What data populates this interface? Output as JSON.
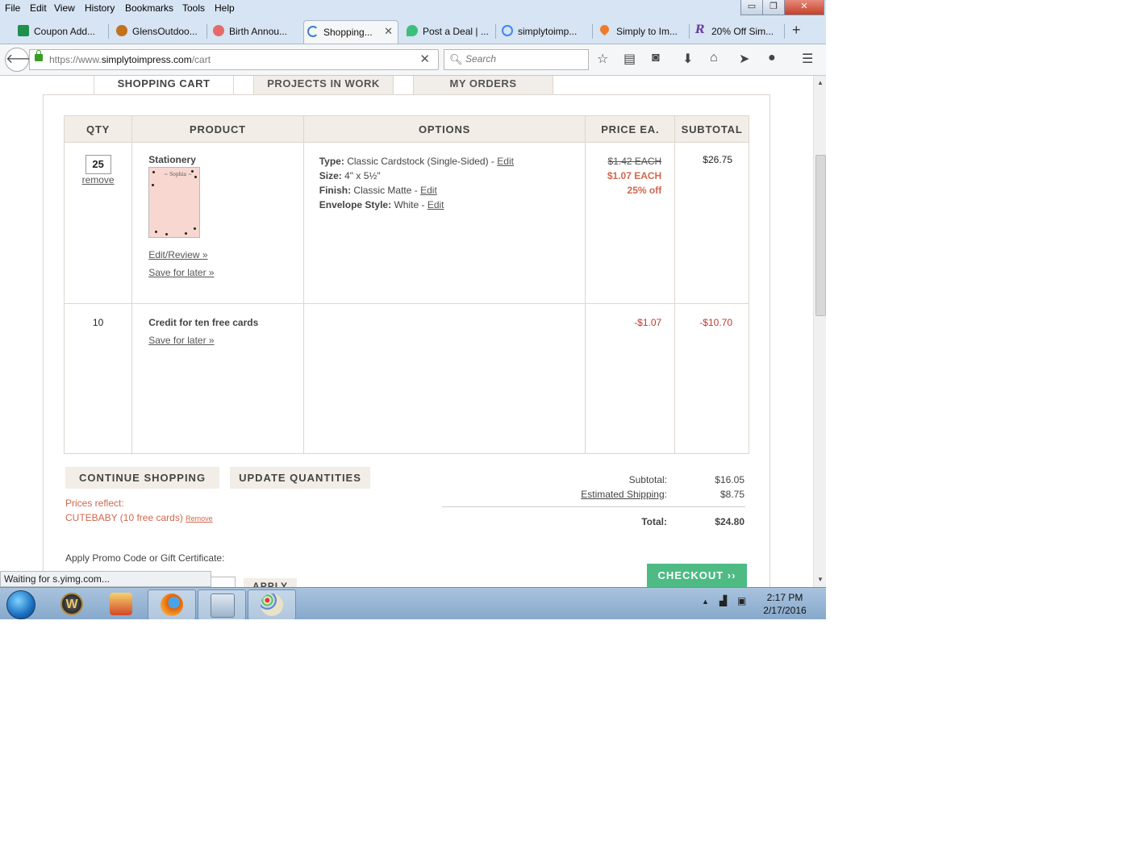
{
  "menu": [
    "File",
    "Edit",
    "View",
    "History",
    "Bookmarks",
    "Tools",
    "Help"
  ],
  "window_controls": [
    "▭",
    "❐",
    "✕"
  ],
  "tabs": [
    {
      "label": "Coupon Add...",
      "color": "#1f8f4e"
    },
    {
      "label": "GlensOutdoo...",
      "color": "#c2711d"
    },
    {
      "label": "Birth Annou...",
      "color": "#e56a6a"
    },
    {
      "label": "Shopping...",
      "color": "#3b7ecf"
    },
    {
      "label": "Post a Deal | ...",
      "color": "#3cbf7a"
    },
    {
      "label": "simplytoimp...",
      "color": "#4285f4"
    },
    {
      "label": "Simply to Im...",
      "color": "#f07b2a"
    },
    {
      "label": "20% Off Sim...",
      "color": "#6b3fa0"
    }
  ],
  "address": {
    "prefix": "https://www.",
    "host": "simplytoimpress.com",
    "path": "/cart"
  },
  "search_placeholder": "Search",
  "page_tabs": {
    "cart": "SHOPPING CART",
    "projects": "PROJECTS IN WORK",
    "orders": "MY ORDERS"
  },
  "table": {
    "headers": {
      "qty": "QTY",
      "product": "PRODUCT",
      "options": "OPTIONS",
      "price": "PRICE EA.",
      "subtotal": "SUBTOTAL"
    },
    "row1": {
      "qty": "25",
      "remove": "remove",
      "product": "Stationery",
      "thumb_text": "~ Sophia ~",
      "edit_review": "Edit/Review »",
      "save_later": "Save for later »",
      "type_label": "Type:",
      "type_value": "Classic Cardstock (Single-Sided) -",
      "size_label": "Size:",
      "size_value": "4\" x 5½\"",
      "finish_label": "Finish:",
      "finish_value": "Classic Matte -",
      "envelope_label": "Envelope Style:",
      "envelope_value": "White -",
      "edit": "Edit",
      "old_price": "$1.42 EACH",
      "new_price": "$1.07 EACH",
      "discount": "25% off",
      "subtotal": "$26.75"
    },
    "row2": {
      "qty": "10",
      "product": "Credit for ten free cards",
      "save_later": "Save for later »",
      "price": "-$1.07",
      "subtotal": "-$10.70"
    }
  },
  "buttons": {
    "continue": "CONTINUE SHOPPING",
    "update": "UPDATE QUANTITIES",
    "checkout": "CHECKOUT ››",
    "apply": "APPLY"
  },
  "promo": {
    "reflect": "Prices reflect:",
    "code": "CUTEBABY (10 free cards)",
    "remove": "Remove",
    "apply_label": "Apply Promo Code or Gift Certificate:"
  },
  "summary": {
    "subtotal_label": "Subtotal:",
    "subtotal": "$16.05",
    "shipping_label": "Estimated Shipping",
    "shipping_colon": ":",
    "shipping": "$8.75",
    "total_label": "Total:",
    "total": "$24.80"
  },
  "status": "Waiting for s.yimg.com...",
  "clock": {
    "time": "2:17 PM",
    "date": "2/17/2016"
  },
  "colors": {
    "accent": "#d2674e",
    "checkout": "#4dbb83",
    "negative": "#c0392b"
  }
}
